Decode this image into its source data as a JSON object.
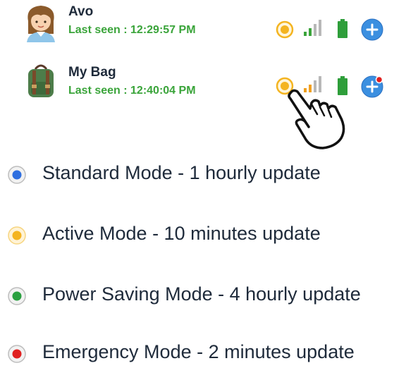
{
  "devices": [
    {
      "name": "Avo",
      "last_seen": "Last seen : 12:29:57 PM",
      "avatar_icon": "girl-avatar-icon",
      "mode": "active",
      "signal_color": "#3aa43a",
      "battery_color": "#2e9e3a"
    },
    {
      "name": "My Bag",
      "last_seen": "Last seen : 12:40:04 PM",
      "avatar_icon": "backpack-avatar-icon",
      "mode": "active",
      "signal_color": "#f0a020",
      "battery_color": "#2e9e3a",
      "locate_notification": true
    }
  ],
  "legend": [
    {
      "label": "Standard Mode - 1 hourly update",
      "color": "#2f6fe0"
    },
    {
      "label": "Active Mode - 10 minutes update",
      "color": "#f4b420"
    },
    {
      "label": "Power Saving Mode - 4 hourly update",
      "color": "#2aa040"
    },
    {
      "label": "Emergency Mode - 2 minutes update",
      "color": "#e02020"
    }
  ],
  "colors": {
    "active": "#f4b420",
    "name_text": "#1e2a3a",
    "last_seen_text": "#3aa43a",
    "locate": "#3b8fe0",
    "notification": "#e02020"
  },
  "icons": [
    "mode-indicator-icon",
    "signal-icon",
    "battery-icon",
    "locate-pin-icon",
    "pointing-hand-icon"
  ]
}
